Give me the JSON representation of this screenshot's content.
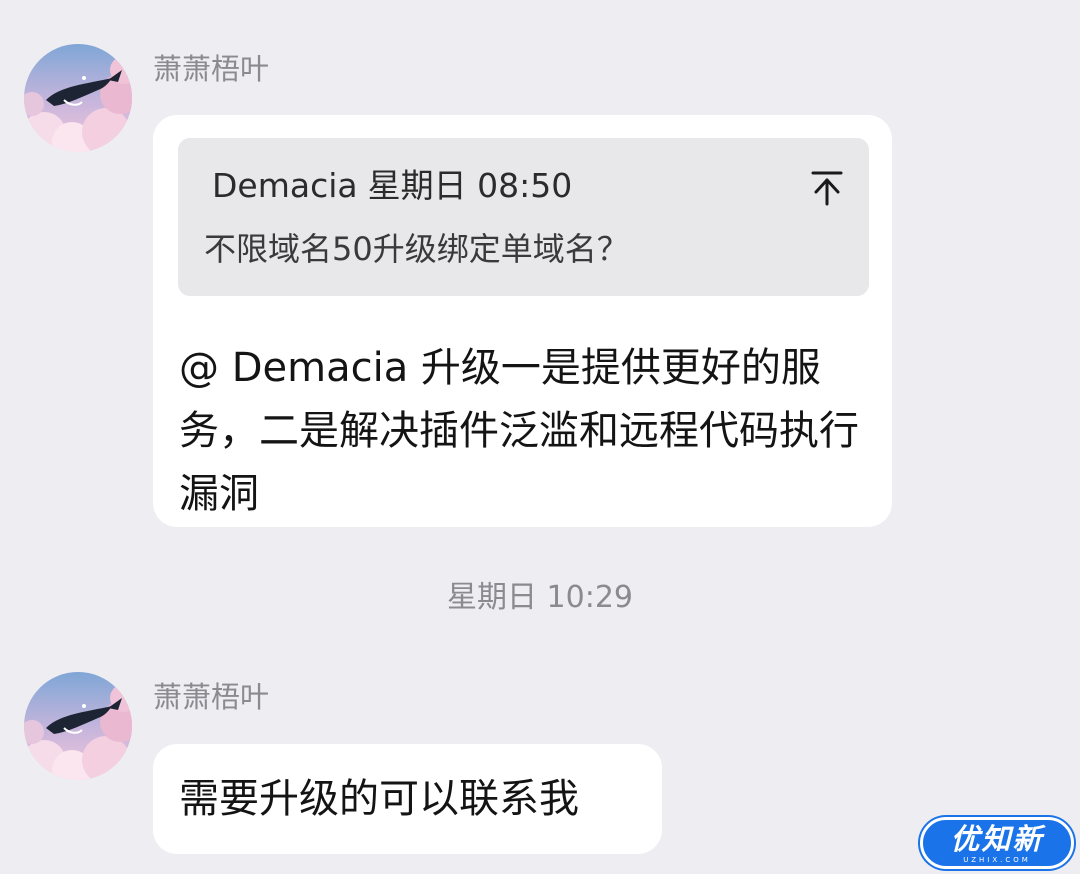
{
  "messages": [
    {
      "sender": "萧萧梧叶",
      "quote": {
        "author": "Demacia",
        "time": "星期日 08:50",
        "text": "不限域名50升级绑定单域名？"
      },
      "text": "@ Demacia 升级一是提供更好的服务，二是解决插件泛滥和远程代码执行漏洞"
    },
    {
      "sender": "萧萧梧叶",
      "text": "需要升级的可以联系我"
    }
  ],
  "time_separator": "星期日 10:29",
  "watermark": {
    "text": "优知新",
    "subtext": "UZHIX.COM"
  },
  "colors": {
    "background": "#ededf2",
    "bubble": "#ffffff",
    "quote_background": "#e8e8ea",
    "watermark": "#1a73e8"
  },
  "icons": {
    "avatar": "whale-in-clouds-avatar",
    "jump_to_quote": "arrow-up-to-bar-icon"
  }
}
